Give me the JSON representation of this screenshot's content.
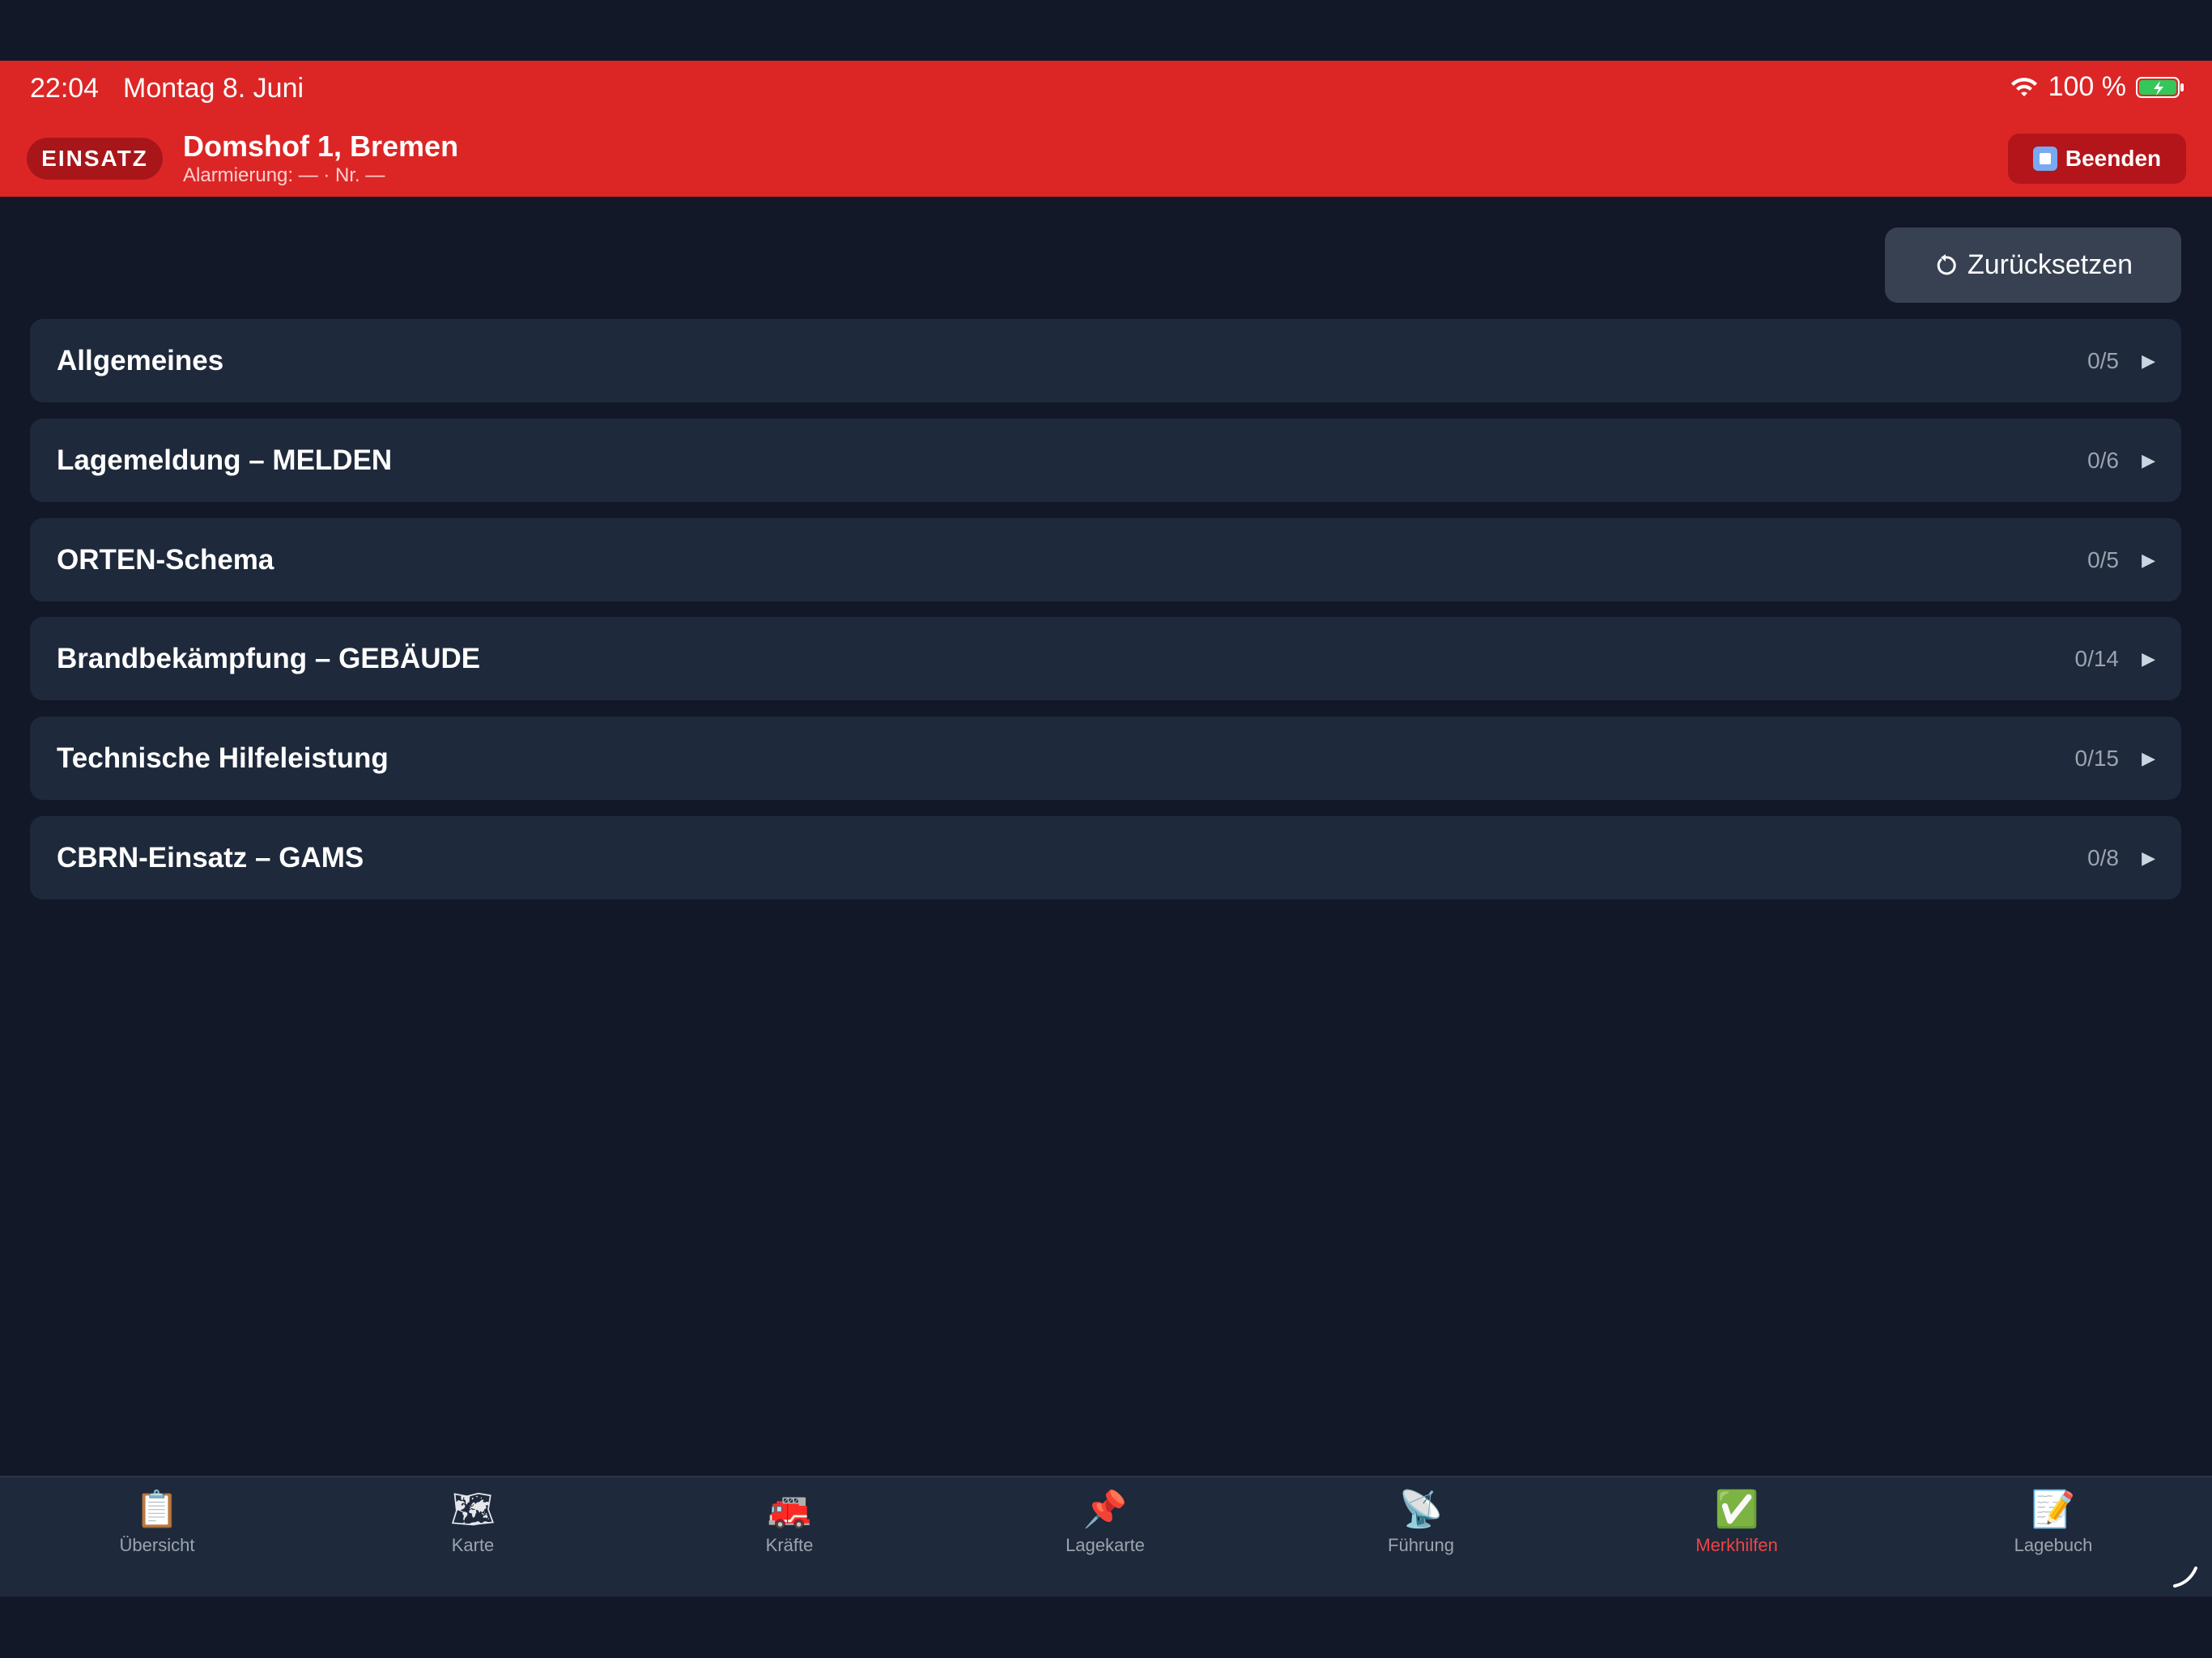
{
  "status_bar": {
    "time": "22:04",
    "date": "Montag 8. Juni",
    "battery": "100 %"
  },
  "header": {
    "badge": "EINSATZ",
    "address": "Domshof 1, Bremen",
    "alarm_info": "Alarmierung: — · Nr. —",
    "end_button": "Beenden"
  },
  "toolbar": {
    "reset_label": "Zurücksetzen"
  },
  "sections": [
    {
      "title": "Allgemeines",
      "count": "0/5"
    },
    {
      "title": "Lagemeldung – MELDEN",
      "count": "0/6"
    },
    {
      "title": "ORTEN-Schema",
      "count": "0/5"
    },
    {
      "title": "Brandbekämpfung – GEBÄUDE",
      "count": "0/14"
    },
    {
      "title": "Technische Hilfeleistung",
      "count": "0/15"
    },
    {
      "title": "CBRN-Einsatz – GAMS",
      "count": "0/8"
    }
  ],
  "tabs": [
    {
      "label": "Übersicht",
      "icon": "clipboard-icon",
      "glyph": "📋"
    },
    {
      "label": "Karte",
      "icon": "map-icon",
      "glyph": "🗺"
    },
    {
      "label": "Kräfte",
      "icon": "fire-engine-icon",
      "glyph": "🚒"
    },
    {
      "label": "Lagekarte",
      "icon": "pushpin-icon",
      "glyph": "📌"
    },
    {
      "label": "Führung",
      "icon": "satellite-dish-icon",
      "glyph": "📡"
    },
    {
      "label": "Merkhilfen",
      "icon": "check-mark-icon",
      "glyph": "✅"
    },
    {
      "label": "Lagebuch",
      "icon": "memo-icon",
      "glyph": "📝"
    }
  ],
  "colors": {
    "accent_red": "#dc2626",
    "background": "#121828",
    "card": "#1e293b",
    "active_tab": "#ef4444"
  }
}
